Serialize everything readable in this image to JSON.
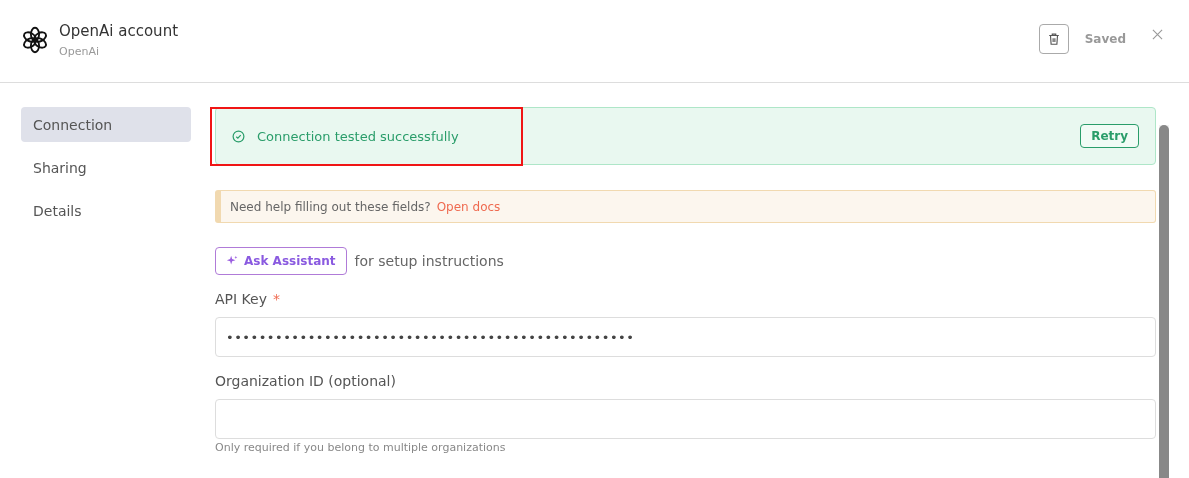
{
  "header": {
    "title": "OpenAi account",
    "subtitle": "OpenAi",
    "status": "Saved"
  },
  "sidebar": {
    "items": [
      {
        "label": "Connection",
        "selected": true
      },
      {
        "label": "Sharing",
        "selected": false
      },
      {
        "label": "Details",
        "selected": false
      }
    ]
  },
  "banner": {
    "message": "Connection tested successfully",
    "button": "Retry",
    "highlighted": true
  },
  "help": {
    "text": "Need help filling out these fields?",
    "link": "Open docs"
  },
  "assistant": {
    "button": "Ask Assistant",
    "text": "for setup instructions"
  },
  "fields": [
    {
      "label": "API Key",
      "required_mark": "*",
      "value": "••••••••••••••••••••••••••••••••••••••••••••••••••"
    },
    {
      "label": "Organization ID (optional)",
      "hint": "Only required if you belong to multiple organizations"
    }
  ]
}
